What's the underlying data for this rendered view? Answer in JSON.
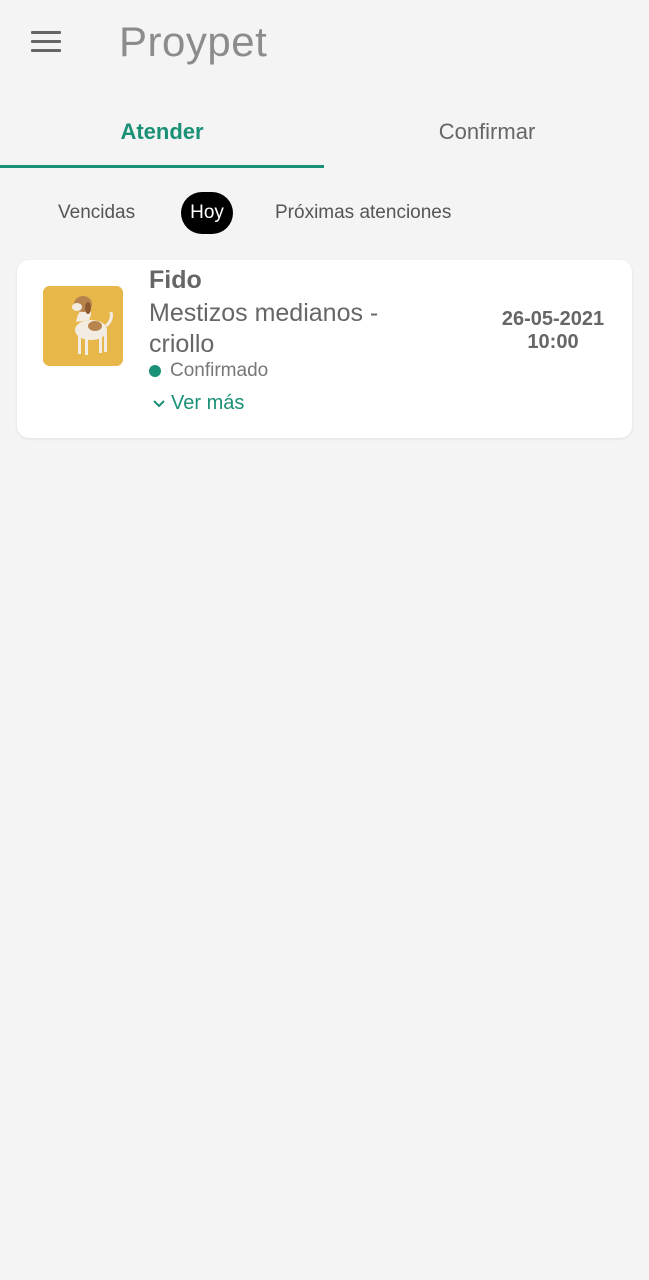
{
  "app_title": "Proypet",
  "icons": {
    "menu": "menu-icon",
    "chevron": "chevron-down-icon",
    "status": "status-dot-icon"
  },
  "colors": {
    "accent": "#1a9077",
    "chip_active_bg": "#000000",
    "background": "#f4f4f4"
  },
  "tabs": [
    {
      "label": "Atender",
      "active": true
    },
    {
      "label": "Confirmar",
      "active": false
    }
  ],
  "filters": [
    {
      "label": "Vencidas",
      "selected": false
    },
    {
      "label": "Hoy",
      "selected": true
    },
    {
      "label": "Próximas atenciones",
      "selected": false
    }
  ],
  "appointments": [
    {
      "name": "Fido",
      "breed": "Mestizos medianos - criollo",
      "status": "Confirmado",
      "more_label": "Ver más",
      "date": "26-05-2021",
      "time": "10:00"
    }
  ]
}
